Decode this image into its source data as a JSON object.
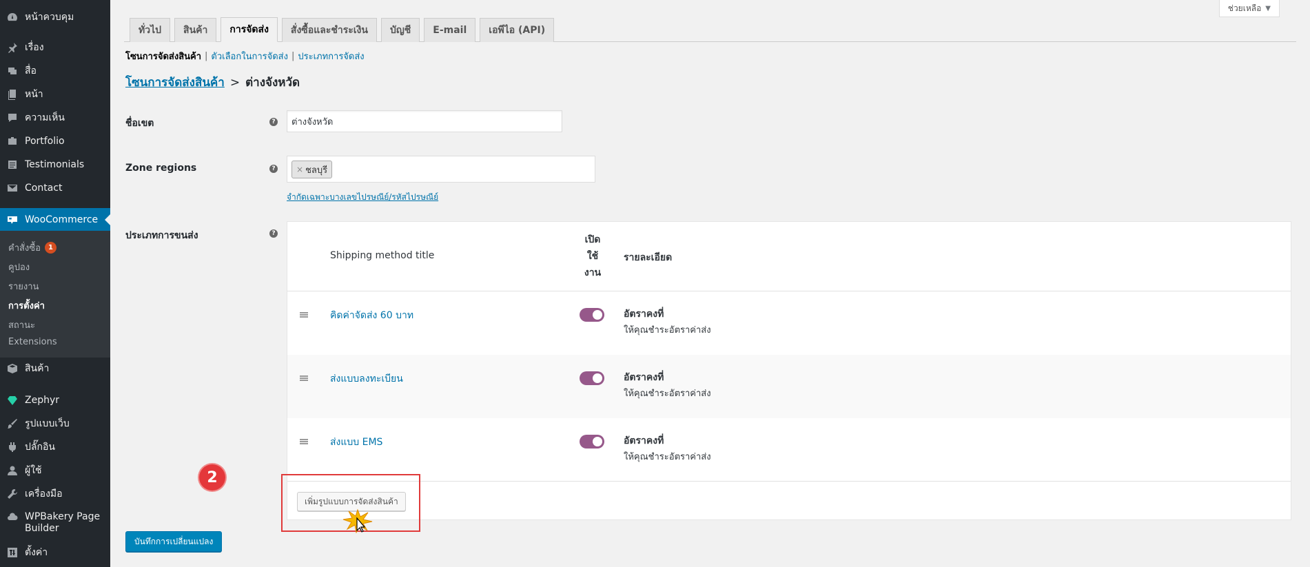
{
  "sidebar": {
    "items": [
      {
        "label": "หน้าควบคุม",
        "icon": "dashboard-icon"
      },
      {
        "label": "เรื่อง",
        "icon": "pin-icon"
      },
      {
        "label": "สื่อ",
        "icon": "media-icon"
      },
      {
        "label": "หน้า",
        "icon": "page-icon"
      },
      {
        "label": "ความเห็น",
        "icon": "comment-icon"
      },
      {
        "label": "Portfolio",
        "icon": "portfolio-icon"
      },
      {
        "label": "Testimonials",
        "icon": "testimonial-icon"
      },
      {
        "label": "Contact",
        "icon": "mail-icon"
      }
    ],
    "woocommerce": {
      "label": "WooCommerce",
      "icon": "woo-icon"
    },
    "submenu": [
      {
        "label": "คำสั่งซื้อ",
        "badge": "1"
      },
      {
        "label": "คูปอง"
      },
      {
        "label": "รายงาน"
      },
      {
        "label": "การตั้งค่า"
      },
      {
        "label": "สถานะ"
      },
      {
        "label": "Extensions"
      }
    ],
    "items_after": [
      {
        "label": "สินค้า",
        "icon": "box-icon"
      },
      {
        "label": "Zephyr",
        "icon": "gem-icon"
      },
      {
        "label": "รูปแบบเว็บ",
        "icon": "brush-icon"
      },
      {
        "label": "ปลั๊กอิน",
        "icon": "plugin-icon"
      },
      {
        "label": "ผู้ใช้",
        "icon": "user-icon"
      },
      {
        "label": "เครื่องมือ",
        "icon": "wrench-icon"
      },
      {
        "label": "WPBakery Page Builder",
        "icon": "cloud-icon"
      },
      {
        "label": "ตั้งค่า",
        "icon": "settings-icon"
      }
    ]
  },
  "help": {
    "label": "ช่วยเหลือ"
  },
  "tabs": [
    {
      "label": "ทั่วไป"
    },
    {
      "label": "สินค้า"
    },
    {
      "label": "การจัดส่ง",
      "active": true
    },
    {
      "label": "สั่งซื้อและชำระเงิน"
    },
    {
      "label": "บัญชี"
    },
    {
      "label": "E-mail"
    },
    {
      "label": "เอพีไอ (API)"
    }
  ],
  "subnav": {
    "current": "โซนการจัดส่งสินค้า",
    "links": [
      "ตัวเลือกในการจัดส่ง",
      "ประเภทการจัดส่ง"
    ]
  },
  "breadcrumb": {
    "link": "โซนการจัดส่งสินค้า",
    "separator": ">",
    "current": "ต่างจังหวัด"
  },
  "form": {
    "zone_name_label": "ชื่อเขต",
    "zone_name_value": "ต่างจังหวัด",
    "zone_regions_label": "Zone regions",
    "region_chip": "ชลบุรี",
    "postcode_link": "จำกัดเฉพาะบางเลขไปรษณีย์/รหัสไปรษณีย์",
    "methods_label": "ประเภทการขนส่ง",
    "help_tip": "?"
  },
  "methods_table": {
    "col_title": "Shipping method title",
    "col_enabled_lines": [
      "เปิด",
      "ใช้",
      "งาน"
    ],
    "col_desc": "รายละเอียด",
    "rows": [
      {
        "title": "คิดค่าจัดส่ง 60 บาท",
        "enabled": true,
        "desc_title": "อัตราคงที่",
        "desc": "ให้คุณชำระอัตราค่าส่ง"
      },
      {
        "title": "ส่งแบบลงทะเบียน",
        "enabled": true,
        "desc_title": "อัตราคงที่",
        "desc": "ให้คุณชำระอัตราค่าส่ง"
      },
      {
        "title": "ส่งแบบ EMS",
        "enabled": true,
        "desc_title": "อัตราคงที่",
        "desc": "ให้คุณชำระอัตราค่าส่ง"
      }
    ],
    "add_button": "เพิ่มรูปแบบการจัดส่งสินค้า"
  },
  "annotation": {
    "step_number": "2",
    "color": "#e4373a"
  },
  "save_button": "บันทึกการเปลี่ยนแปลง",
  "colors": {
    "sidebar_bg": "#23282d",
    "active_menu": "#0073aa",
    "toggle_on": "#96588a",
    "primary_button": "#0085ba"
  }
}
